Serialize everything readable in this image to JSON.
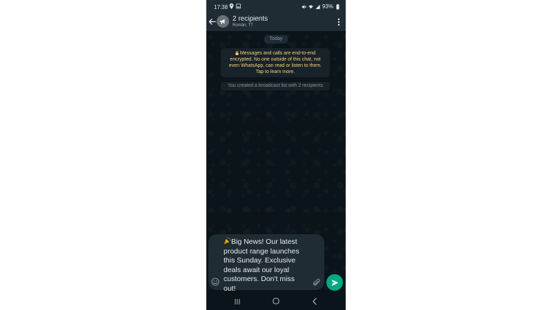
{
  "status_bar": {
    "time": "17:38",
    "battery": "93%",
    "left_icons": [
      "location-icon",
      "image-icon"
    ],
    "right_icons": [
      "mute-icon",
      "wifi-icon",
      "signal-icon",
      "battery-icon"
    ]
  },
  "header": {
    "title": "2 recipients",
    "subtitle": "Român, TT",
    "back_icon": "arrow-left-icon",
    "avatar_icon": "broadcast-icon",
    "menu_icon": "more-vertical-icon"
  },
  "chat": {
    "date_chip": "Today",
    "encryption_notice_lines": [
      "Messages and calls are end-to-end",
      "encrypted. No one outside of this chat, not",
      "even WhatsApp, can read or listen to them.",
      "Tap to learn more."
    ],
    "system_message": "You created a broadcast list with 2 recipients"
  },
  "composer": {
    "message_lines": [
      "Big News! Our latest",
      "product range launches",
      "this Sunday. Exclusive",
      "deals await our loyal",
      "customers. Don't miss",
      "out!"
    ],
    "leading_emoji": "party-popper-icon",
    "emoji_button_icon": "smiley-icon",
    "attach_icon": "paperclip-icon",
    "send_icon": "send-icon"
  },
  "nav_bar": {
    "icons": [
      "recents-icon",
      "home-icon",
      "back-icon"
    ]
  },
  "colors": {
    "app_bar": "#1f2c34",
    "chat_background": "#0b141a",
    "notice_background": "#182229",
    "notice_text": "#ffd279",
    "accent_green": "#00a884",
    "primary_text": "#e9edef",
    "secondary_text": "#8696a0"
  }
}
